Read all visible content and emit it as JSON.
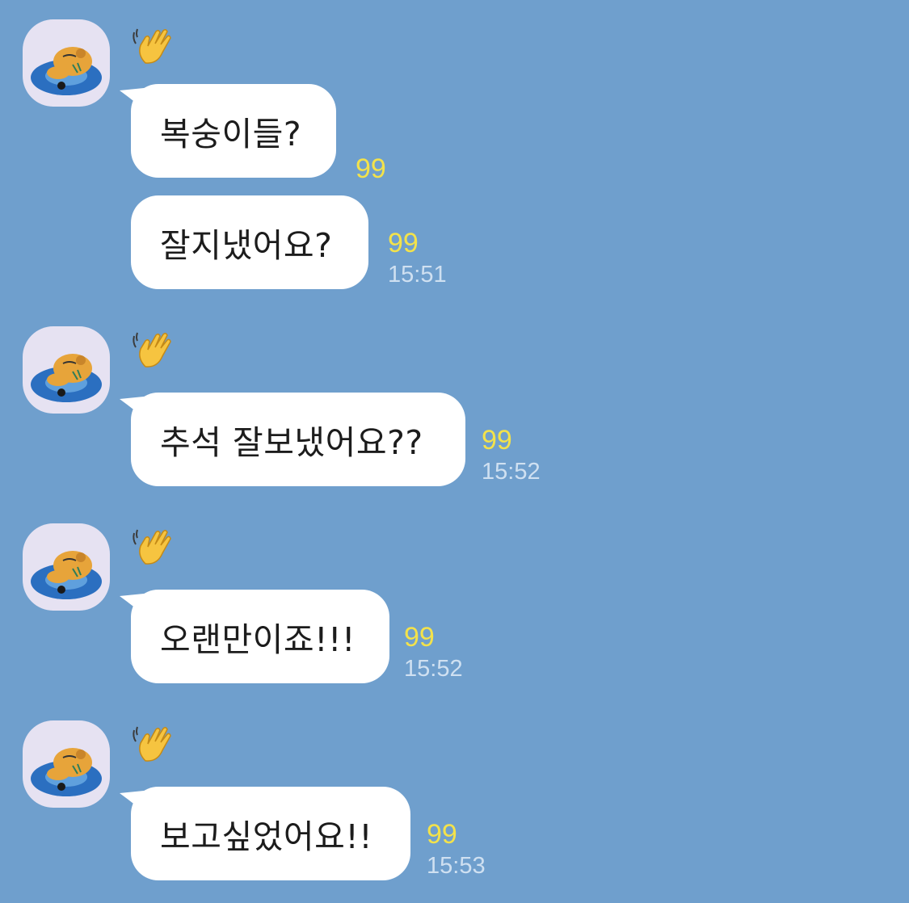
{
  "chat": {
    "messages": [
      {
        "text": "복숭이들?",
        "unread": "99",
        "time": ""
      },
      {
        "text": "잘지냈어요?",
        "unread": "99",
        "time": "15:51"
      },
      {
        "text": "추석 잘보냈어요??",
        "unread": "99",
        "time": "15:52"
      },
      {
        "text": "오랜만이죠!!!",
        "unread": "99",
        "time": "15:52"
      },
      {
        "text": "보고싶었어요!!",
        "unread": "99",
        "time": "15:53"
      }
    ]
  },
  "colors": {
    "background": "#6f9fcd",
    "bubble": "#ffffff",
    "unread": "#f3e24b",
    "time": "#cfe0f1",
    "avatar_bg": "#e6e2f2"
  },
  "icons": {
    "avatar": "ryan-on-float-avatar-icon",
    "sender": "waving-hand-icon"
  }
}
